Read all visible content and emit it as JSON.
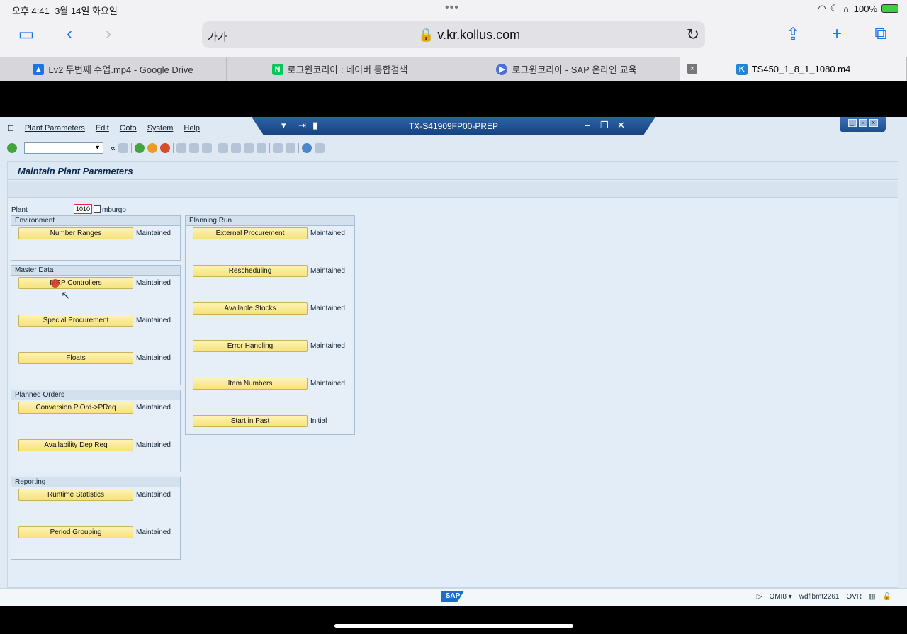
{
  "ios": {
    "time": "오후 4:41",
    "date": "3월 14일 화요일",
    "battery": "100%",
    "url_aa": "가가",
    "url_host": "v.kr.kollus.com"
  },
  "tabs": [
    {
      "label": "Lv2 두번째 수업.mp4 - Google Drive",
      "active": false,
      "icon": "google-drive-icon",
      "color": "#1a73e8"
    },
    {
      "label": "로그윈코리아 : 네이버 통합검색",
      "active": false,
      "icon": "naver-icon",
      "color": "#03c75a"
    },
    {
      "label": "로그윈코리아 - SAP 온라인 교육",
      "active": false,
      "icon": "play-icon",
      "color": "#4a6fd6"
    },
    {
      "label": "TS450_1_8_1_1080.m4",
      "active": true,
      "icon": "kollus-icon",
      "color": "#1f86d6"
    }
  ],
  "sap": {
    "window_title": "TX-S41909FP00-PREP",
    "menu": [
      "Plant Parameters",
      "Edit",
      "Goto",
      "System",
      "Help"
    ],
    "screen_title": "Maintain Plant Parameters",
    "plant_label": "Plant",
    "plant_value": "1010",
    "plant_desc": "mburgo",
    "groups": [
      {
        "title": "Environment",
        "rows": [
          {
            "label": "Number Ranges",
            "status": "Maintained"
          }
        ]
      },
      {
        "title": "Master Data",
        "rows": [
          {
            "label": "MRP Controllers",
            "status": "Maintained"
          },
          {
            "label": "Special Procurement",
            "status": "Maintained"
          },
          {
            "label": "Floats",
            "status": "Maintained"
          }
        ]
      },
      {
        "title": "Planned Orders",
        "rows": [
          {
            "label": "Conversion PlOrd->PReq",
            "status": "Maintained"
          },
          {
            "label": "Availability Dep Req",
            "status": "Maintained"
          }
        ]
      },
      {
        "title": "Reporting",
        "rows": [
          {
            "label": "Runtime Statistics",
            "status": "Maintained"
          },
          {
            "label": "Period Grouping",
            "status": "Maintained"
          }
        ]
      },
      {
        "title": "Planning Run",
        "rows": [
          {
            "label": "External Procurement",
            "status": "Maintained"
          },
          {
            "label": "Rescheduling",
            "status": "Maintained"
          },
          {
            "label": "Available Stocks",
            "status": "Maintained"
          },
          {
            "label": "Error Handling",
            "status": "Maintained"
          },
          {
            "label": "Item Numbers",
            "status": "Maintained"
          },
          {
            "label": "Start in Past",
            "status": "Initial"
          }
        ]
      }
    ],
    "status_system": "OMI8",
    "status_host": "wdflbmt2261",
    "status_mode": "OVR",
    "sap_logo": "SAP"
  }
}
